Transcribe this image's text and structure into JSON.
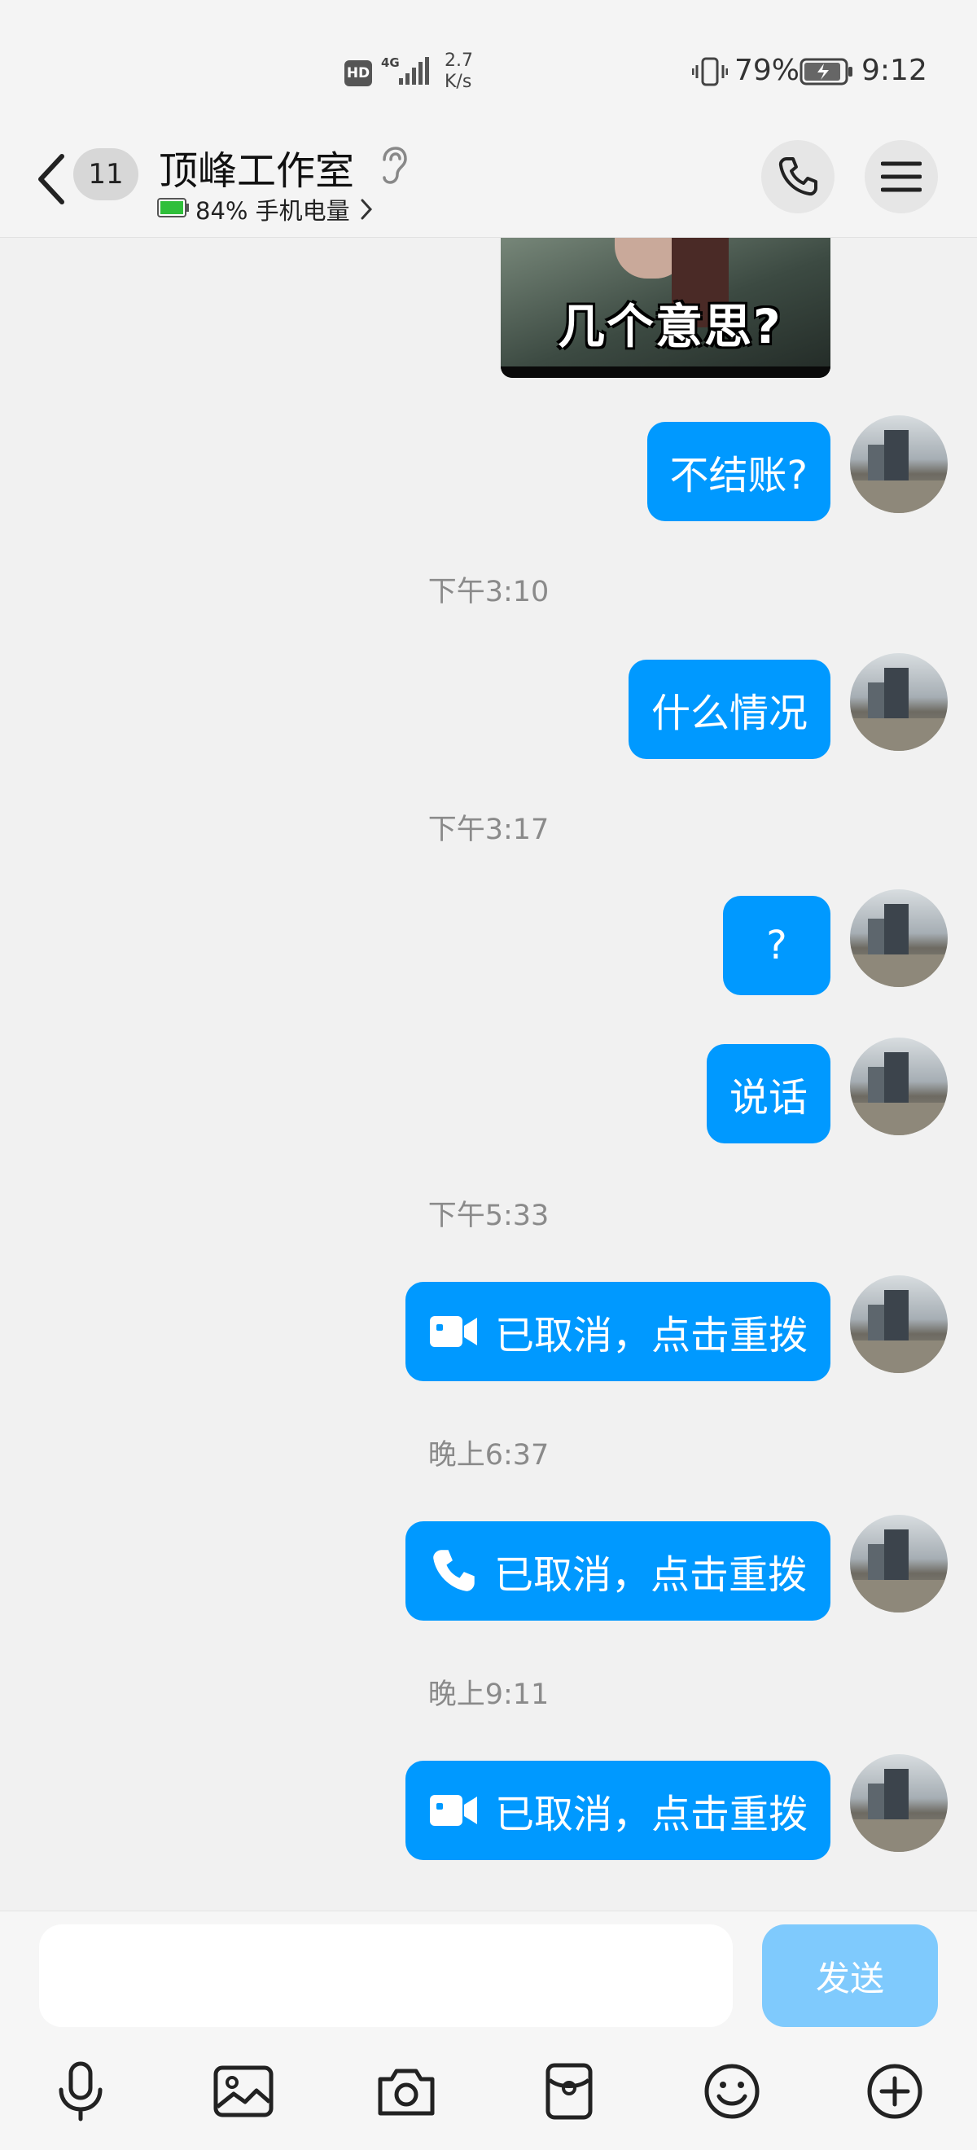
{
  "status_bar": {
    "hd": "HD",
    "network": "4G",
    "speed_value": "2.7",
    "speed_unit": "K/s",
    "battery": "79%",
    "time": "9:12"
  },
  "header": {
    "unread_count": "11",
    "title": "顶峰工作室",
    "phone_battery": "84% 手机电量"
  },
  "messages": [
    {
      "type": "sticker",
      "caption": "几个意思?"
    },
    {
      "type": "text",
      "text": "不结账?"
    },
    {
      "type": "time",
      "text": "下午3:10"
    },
    {
      "type": "text",
      "text": "什么情况"
    },
    {
      "type": "time",
      "text": "下午3:17"
    },
    {
      "type": "text",
      "text": "?"
    },
    {
      "type": "text",
      "text": "说话"
    },
    {
      "type": "time",
      "text": "下午5:33"
    },
    {
      "type": "call",
      "icon": "video-camera-icon",
      "text": "已取消，点击重拨"
    },
    {
      "type": "time",
      "text": "晚上6:37"
    },
    {
      "type": "call",
      "icon": "phone-icon",
      "text": "已取消，点击重拨"
    },
    {
      "type": "time",
      "text": "晚上9:11"
    },
    {
      "type": "call",
      "icon": "video-camera-icon",
      "text": "已取消，点击重拨"
    }
  ],
  "input": {
    "value": "",
    "send_label": "发送"
  },
  "toolbar_icons": [
    "microphone-icon",
    "image-icon",
    "camera-icon",
    "red-packet-icon",
    "emoji-icon",
    "plus-icon"
  ],
  "colors": {
    "bubble": "#0099ff",
    "send_disabled": "#7fcafd",
    "background": "#f1f1f1"
  }
}
